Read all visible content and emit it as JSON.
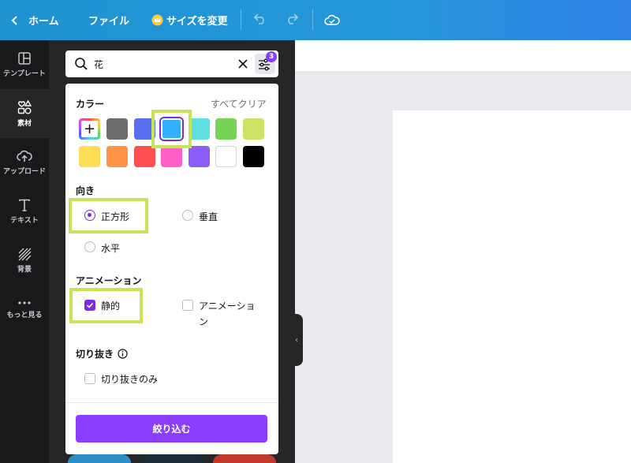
{
  "topbar": {
    "home_label": "ホーム",
    "file_label": "ファイル",
    "resize_label": "サイズを変更"
  },
  "sidebar": {
    "items": [
      {
        "label": "テンプレート",
        "icon": "template-icon"
      },
      {
        "label": "素材",
        "icon": "elements-icon"
      },
      {
        "label": "アップロード",
        "icon": "upload-icon"
      },
      {
        "label": "テキスト",
        "icon": "text-icon"
      },
      {
        "label": "背景",
        "icon": "background-icon"
      },
      {
        "label": "もっと見る",
        "icon": "more-icon"
      }
    ]
  },
  "search": {
    "query": "花",
    "filter_count": "3"
  },
  "filters": {
    "color_title": "カラー",
    "clear_all": "すべてクリア",
    "colors": [
      "#6d6d6d",
      "#5b6df0",
      "#33b1ff",
      "#5ee0e3",
      "#76d454",
      "#cde366",
      "#ffdd57",
      "#ff9245",
      "#ff5050",
      "#ff5fc6",
      "#8b5cf6",
      "#ffffff",
      "#000000"
    ],
    "selected_color": "#33b1ff",
    "orientation_title": "向き",
    "orientation_options": {
      "square": "正方形",
      "vertical": "垂直",
      "horizontal": "水平"
    },
    "orientation_selected": "正方形",
    "animation_title": "アニメーション",
    "animation_options": {
      "static": "静的",
      "animated_line1": "アニメーショ",
      "animated_line2": "ン"
    },
    "animation_checked": "静的",
    "cutout_title": "切り抜き",
    "cutout_option": "切り抜きのみ",
    "apply_label": "絞り込む"
  },
  "accent_color": "#8b3dff",
  "highlight_color": "#c7e457"
}
